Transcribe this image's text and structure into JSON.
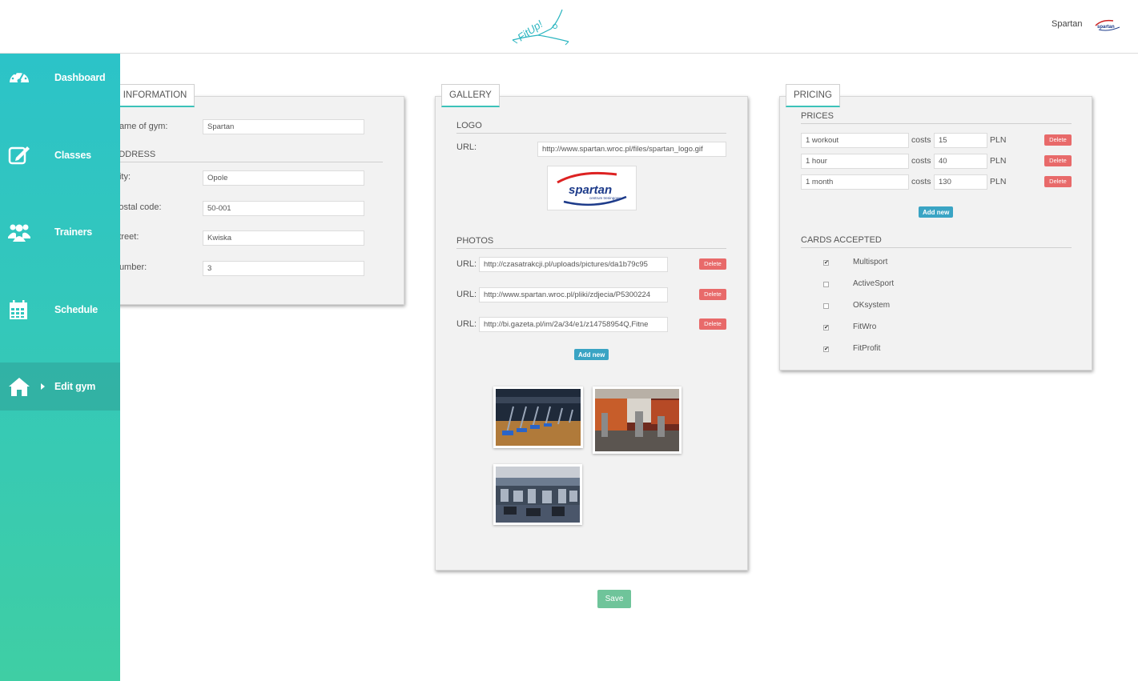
{
  "header": {
    "user_name": "Spartan",
    "logo_text": "FitUp!"
  },
  "sidebar": {
    "items": [
      {
        "label": "Dashboard",
        "icon": "dashboard-gauge-icon"
      },
      {
        "label": "Classes",
        "icon": "edit-icon"
      },
      {
        "label": "Trainers",
        "icon": "users-icon"
      },
      {
        "label": "Schedule",
        "icon": "calendar-icon"
      },
      {
        "label": "Edit gym",
        "icon": "home-icon",
        "active": true
      }
    ]
  },
  "basic": {
    "tab": "BASIC INFORMATION",
    "name_label": "Name of gym:",
    "name_value": "Spartan",
    "address_title": "ADDRESS",
    "city_label": "City:",
    "city_value": "Opole",
    "postal_label": "Postal code:",
    "postal_value": "50-001",
    "street_label": "Street:",
    "street_value": "Kwiska",
    "number_label": "Number:",
    "number_value": "3"
  },
  "gallery": {
    "tab": "GALLERY",
    "logo_title": "LOGO",
    "logo_url_label": "URL:",
    "logo_url": "http://www.spartan.wroc.pl/files/spartan_logo.gif",
    "logo_brand": "spartan",
    "logo_sub": "centrum treningowe",
    "photos_title": "PHOTOS",
    "photos": [
      {
        "label": "URL:",
        "url": "http://czasatrakcji.pl/uploads/pictures/da1b79c95",
        "delete": "Delete"
      },
      {
        "label": "URL:",
        "url": "http://www.spartan.wroc.pl/pliki/zdjecia/P5300224",
        "delete": "Delete"
      },
      {
        "label": "URL:",
        "url": "http://bi.gazeta.pl/im/2a/34/e1/z14758954Q,Fitne",
        "delete": "Delete"
      }
    ],
    "add_new": "Add new"
  },
  "pricing": {
    "tab": "PRICING",
    "prices_title": "PRICES",
    "prices": [
      {
        "name": "1 workout",
        "costs": "costs",
        "value": "15",
        "unit": "PLN",
        "delete": "Delete"
      },
      {
        "name": "1 hour",
        "costs": "costs",
        "value": "40",
        "unit": "PLN",
        "delete": "Delete"
      },
      {
        "name": "1 month",
        "costs": "costs",
        "value": "130",
        "unit": "PLN",
        "delete": "Delete"
      }
    ],
    "add_new": "Add new",
    "cards_title": "CARDS ACCEPTED",
    "cards": [
      {
        "name": "Multisport",
        "checked": true
      },
      {
        "name": "ActiveSport",
        "checked": false
      },
      {
        "name": "OKsystem",
        "checked": false
      },
      {
        "name": "FitWro",
        "checked": true
      },
      {
        "name": "FitProfit",
        "checked": true
      }
    ]
  },
  "save_label": "Save",
  "colors": {
    "sidebar_top": "#2cc3c8",
    "sidebar_bottom": "#3fcea4",
    "delete": "#e86a6a",
    "add": "#3aa4c4",
    "save": "#6fc49a"
  }
}
